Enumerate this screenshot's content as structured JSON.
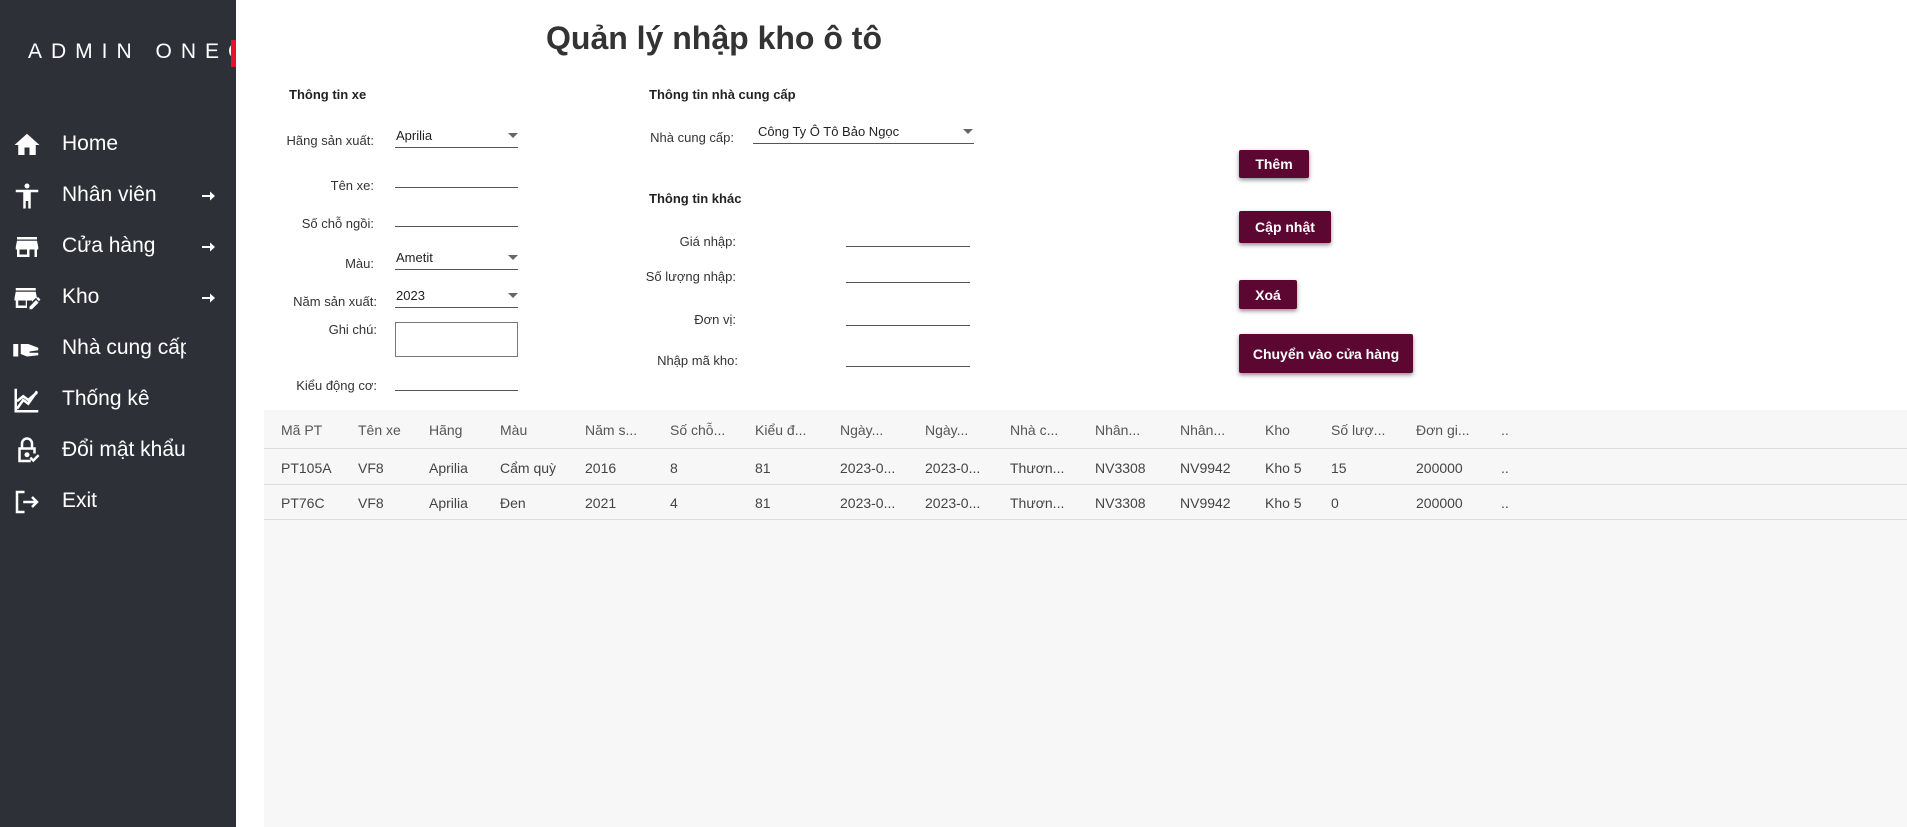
{
  "sidebar": {
    "brand": "ADMIN ONEG",
    "brand_color": "#e8112d",
    "background": "#2d3137",
    "items": [
      {
        "label": "Home",
        "icon": "home-icon",
        "has_arrow": false
      },
      {
        "label": "Nhân viên",
        "icon": "person-icon",
        "has_arrow": true
      },
      {
        "label": "Cửa hàng",
        "icon": "store-icon",
        "has_arrow": true
      },
      {
        "label": "Kho",
        "icon": "warehouse-edit-icon",
        "has_arrow": true
      },
      {
        "label": "Nhà cung cấp",
        "icon": "supplier-hand-icon",
        "has_arrow": false
      },
      {
        "label": "Thống kê",
        "icon": "chart-line-icon",
        "has_arrow": false
      },
      {
        "label": "Đổi mật khẩu",
        "icon": "lock-check-icon",
        "has_arrow": false
      },
      {
        "label": "Exit",
        "icon": "exit-icon",
        "has_arrow": false
      }
    ]
  },
  "main": {
    "title": "Quản lý nhập kho ô tô",
    "car_info": {
      "section_title": "Thông tin xe",
      "manufacturer_label": "Hãng sản xuất:",
      "manufacturer_value": "Aprilia",
      "car_name_label": "Tên xe:",
      "car_name_value": "",
      "seats_label": "Số chỗ ngồi:",
      "seats_value": "",
      "color_label": "Màu:",
      "color_value": "Ametit",
      "year_label": "Năm sản xuất:",
      "year_value": "2023",
      "note_label": "Ghi chú:",
      "note_value": "",
      "engine_label": "Kiểu động cơ:",
      "engine_value": ""
    },
    "supplier_info": {
      "section_title": "Thông tin nhà cung cấp",
      "supplier_label": "Nhà cung cấp:",
      "supplier_value": "Công Ty  Ô Tô Bảo Ngọc"
    },
    "other_info": {
      "section_title": "Thông tin khác",
      "price_label": "Giá nhập:",
      "price_value": "",
      "quantity_label": "Số lượng nhập:",
      "quantity_value": "",
      "unit_label": "Đơn vị:",
      "unit_value": "",
      "warehouse_code_label": "Nhập mã kho:",
      "warehouse_code_value": ""
    },
    "buttons": {
      "add": "Thêm",
      "update": "Cập nhật",
      "delete": "Xoá",
      "move_to_store": "Chuyển vào cửa hàng",
      "color": "#5c0632"
    }
  },
  "table": {
    "columns": [
      "Mã PT",
      "Tên xe",
      "Hãng",
      "Màu",
      "Năm s...",
      "Số chỗ...",
      "Kiểu đ...",
      "Ngày...",
      "Ngày...",
      "Nhà c...",
      "Nhân...",
      "Nhân...",
      "Kho",
      "Số lượ...",
      "Đơn gi...",
      ".."
    ],
    "rows": [
      [
        "PT105A",
        "VF8",
        "Aprilia",
        "Cẩm quỳ",
        "2016",
        "8",
        "81",
        "2023-0...",
        "2023-0...",
        "Thươn...",
        "NV3308",
        "NV9942",
        "Kho 5",
        "15",
        "200000",
        ".."
      ],
      [
        "PT76C",
        "VF8",
        "Aprilia",
        "Đen",
        "2021",
        "4",
        "81",
        "2023-0...",
        "2023-0...",
        "Thươn...",
        "NV3308",
        "NV9942",
        "Kho 5",
        "0",
        "200000",
        ".."
      ]
    ]
  }
}
